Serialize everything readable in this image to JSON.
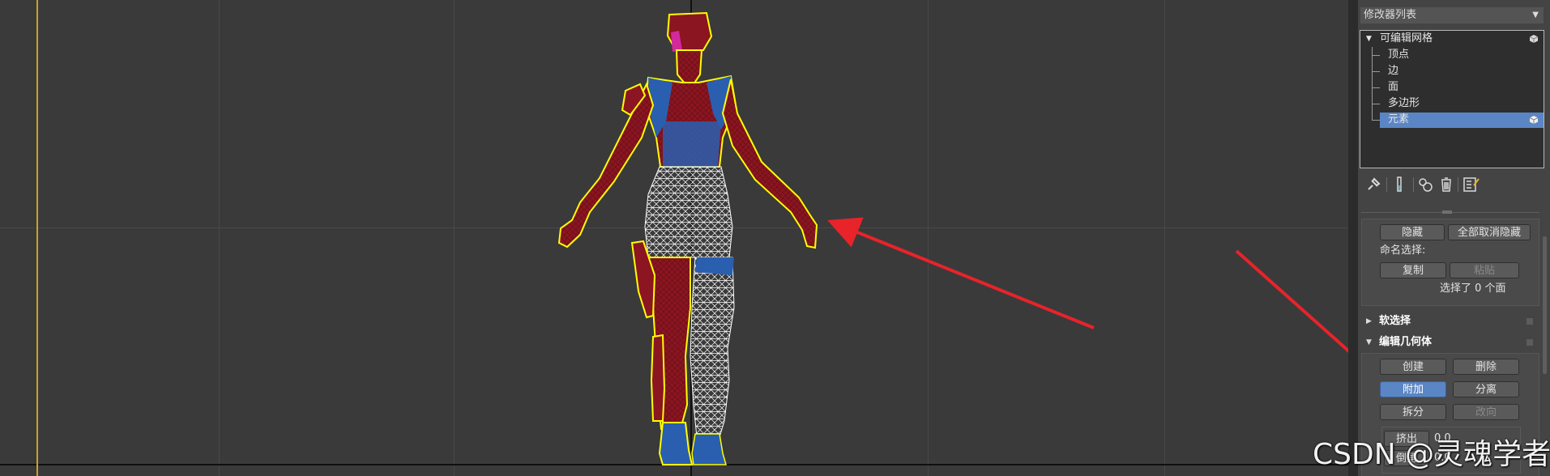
{
  "modifier_panel": {
    "dropdown": {
      "label": "修改器列表"
    },
    "stack": {
      "root": {
        "label": "可编辑网格",
        "expanded": true
      },
      "items": [
        {
          "label": "顶点",
          "selected": false
        },
        {
          "label": "边",
          "selected": false
        },
        {
          "label": "面",
          "selected": false
        },
        {
          "label": "多边形",
          "selected": false
        },
        {
          "label": "元素",
          "selected": true
        }
      ]
    },
    "toolbar": {
      "icons": [
        "pin-stack-icon",
        "show-end-result-icon",
        "make-unique-icon",
        "remove-modifier-icon",
        "configure-modifier-sets-icon"
      ]
    },
    "selection": {
      "hide_button": "隐藏",
      "unhide_all_button": "全部取消隐藏",
      "named_selection_label": "命名选择:",
      "copy_button": "复制",
      "paste_button": "粘贴",
      "status": "选择了 0 个面"
    },
    "soft_selection": {
      "title": "软选择",
      "expanded": false
    },
    "edit_geometry": {
      "title": "编辑几何体",
      "expanded": true,
      "create_button": "创建",
      "delete_button": "删除",
      "attach_button": "附加",
      "detach_button": "分离",
      "divide_button": "拆分",
      "turn_button": "改向",
      "extrude_label": "挤出",
      "extrude_value": "0.0",
      "chamfer_label": "倒角",
      "chamfer_value": "0.0"
    }
  },
  "watermark": "CSDN @灵魂学者",
  "colors": {
    "viewport_bg": "#3a3a3a",
    "selected_mesh": "#8b1520",
    "unselected_mesh": "#2a5fb0",
    "wireframe": "#ffffff",
    "selection_outline": "#ffff00",
    "annotation_arrow": "#e8232a",
    "active_button": "#5b86c5"
  }
}
